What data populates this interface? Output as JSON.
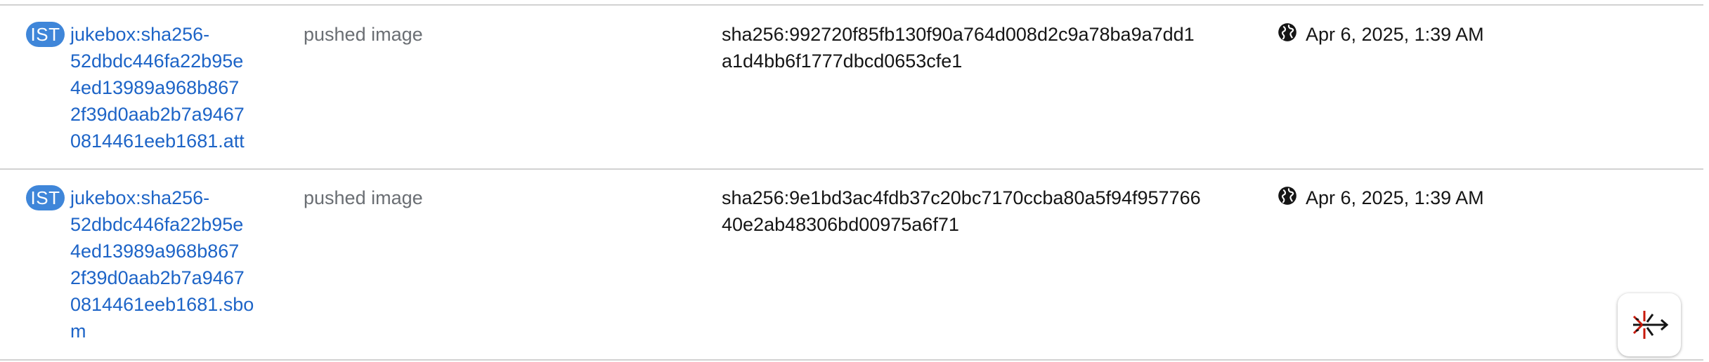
{
  "rows": [
    {
      "badge": "IST",
      "name_lines": [
        "jukebox:sha256-",
        "52dbdc446fa22b95e",
        "4ed13989a968b867",
        "2f39d0aab2b7a9467",
        "0814461eeb1681.att"
      ],
      "action": "pushed image",
      "digest_lines": [
        "sha256:992720f85fb130f90a764d008d2c9a78ba9a7dd1",
        "a1d4bb6f1777dbcd0653cfe1"
      ],
      "icon": "globe-icon",
      "date": "Apr 6, 2025, 1:39 AM"
    },
    {
      "badge": "IST",
      "name_lines": [
        "jukebox:sha256-",
        "52dbdc446fa22b95e",
        "4ed13989a968b867",
        "2f39d0aab2b7a9467",
        "0814461eeb1681.sbo",
        "m"
      ],
      "action": "pushed image",
      "digest_lines": [
        "sha256:9e1bd3ac4fdb37c20bc7170ccba80a5f94f957766",
        "40e2ab48306bd00975a6f71"
      ],
      "icon": "globe-icon",
      "date": "Apr 6, 2025, 1:39 AM"
    }
  ],
  "fab": {
    "icon": "quick-start-icon"
  },
  "colors": {
    "badge_bg": "#3f86d9",
    "link": "#1d64c7",
    "muted": "#6a6e73",
    "text": "#151515",
    "border": "#d2d2d2",
    "fab_red": "#c9190b"
  }
}
